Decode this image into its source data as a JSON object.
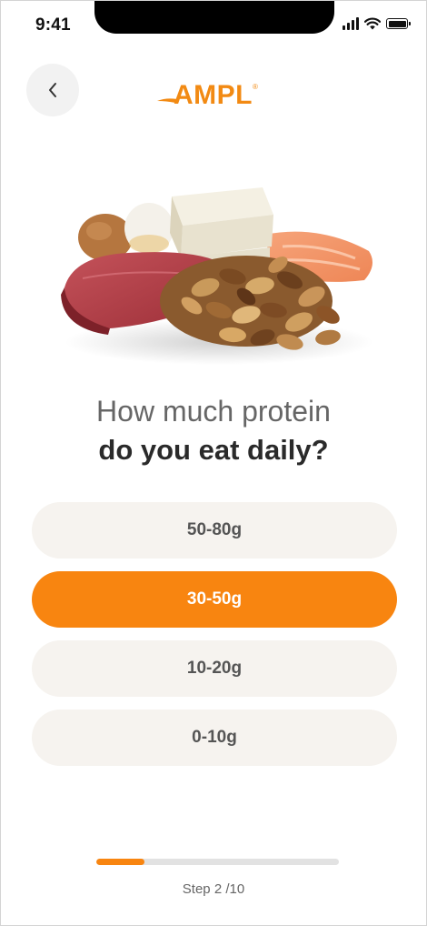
{
  "status_bar": {
    "time": "9:41"
  },
  "header": {
    "back_icon": "chevron-left-icon",
    "logo_text": "AMPL",
    "logo_mark": "®"
  },
  "question": {
    "line1": "How much protein",
    "line2": "do you eat daily?"
  },
  "options": [
    {
      "label": "50-80g",
      "selected": false
    },
    {
      "label": "30-50g",
      "selected": true
    },
    {
      "label": "10-20g",
      "selected": false
    },
    {
      "label": "0-10g",
      "selected": false
    }
  ],
  "progress": {
    "current_step": 2,
    "total_steps": 10,
    "fraction": 0.2,
    "label": "Step 2 /10"
  },
  "colors": {
    "accent": "#f88510",
    "option_bg": "#f6f3ef",
    "logo": "#f28a13"
  }
}
